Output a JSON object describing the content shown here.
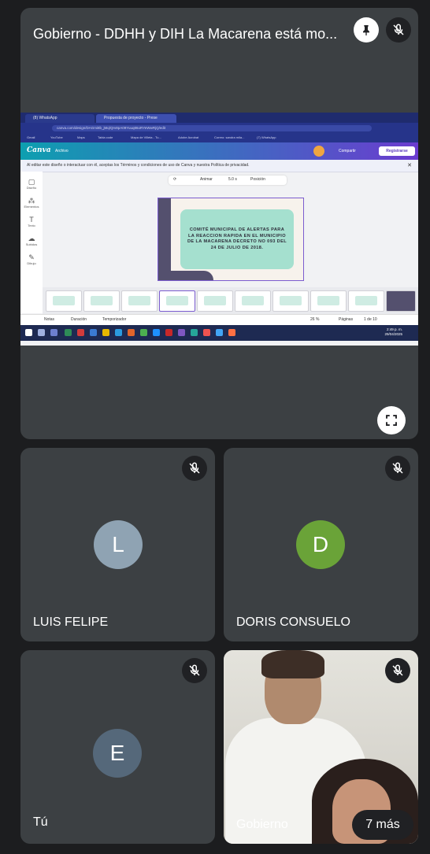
{
  "presentation": {
    "title": "Gobierno - DDHH y DIH La Macarena está mo...",
    "pin_icon": "pin-icon",
    "mic_icon": "mic-off-icon",
    "expand_icon": "fullscreen-icon"
  },
  "shared_screen": {
    "tabs": [
      "(8) WhatsApp",
      "Propuesta de proyecto - Prese"
    ],
    "url": "canva.com/design/DAGmi8b_jMq/Qrv8pA09Yuuq86oRYeWwRjQ/edit",
    "bookmarks": [
      "Gmail",
      "YouTube",
      "Maps",
      "Tabla code",
      "Mapa de Villeta - Tu...",
      "Adobe Acrobat",
      "Correo: sandra mila...",
      "(7) WhatsApp"
    ],
    "canva_logo": "Canva",
    "canva_menu": "Archivo",
    "share_label": "Compartir",
    "register_label": "Registrarse",
    "notice": "Al editar este diseño o interactuar con él, aceptas los Términos y condiciones de uso de Canva y nuestra Política de privacidad.",
    "rail": [
      "Diseño",
      "Elementos",
      "Texto",
      "Subidos",
      "Dibujo"
    ],
    "toolbar": [
      "Animar",
      "5.0 s",
      "Posición"
    ],
    "slide_text": "COMITÉ MUNICIPAL DE ALERTAS PARA LA REACCION RAPIDA EN EL MUNICIPIO DE LA MACARENA DECRETO NO 093 DEL 24 DE JULIO DE 2018.",
    "bottom": [
      "Notas",
      "Duración",
      "Temporizador",
      "26 %",
      "Páginas",
      "1 de 10"
    ],
    "clock": [
      "2:49 p. m.",
      "29/04/2025"
    ]
  },
  "participants": [
    {
      "name": "LUIS FELIPE",
      "initial": "L",
      "color": "#8fa3b3"
    },
    {
      "name": "DORIS CONSUELO",
      "initial": "D",
      "color": "#6aa338"
    },
    {
      "name": "Tú",
      "initial": "E",
      "color": "#55687a"
    },
    {
      "name": "Gobierno",
      "more_label": "7 más"
    }
  ]
}
